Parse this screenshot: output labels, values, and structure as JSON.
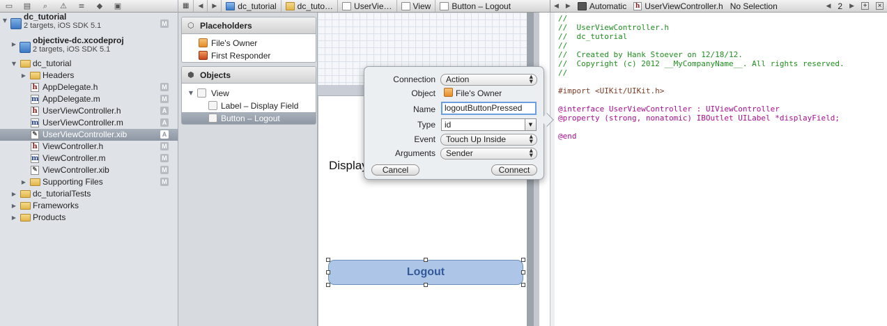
{
  "navigator": {
    "tree": [
      {
        "name": "dc_tutorial",
        "sub": "2 targets, iOS SDK 5.1",
        "status": "M"
      },
      {
        "name": "objective-dc.xcodeproj",
        "sub": "2 targets, iOS SDK 5.1"
      },
      {
        "name": "dc_tutorial"
      },
      {
        "name": "Headers"
      },
      {
        "name": "AppDelegate.h",
        "status": "M"
      },
      {
        "name": "AppDelegate.m",
        "status": "M"
      },
      {
        "name": "UserViewController.h",
        "status": "A"
      },
      {
        "name": "UserViewController.m",
        "status": "A"
      },
      {
        "name": "UserViewController.xib",
        "status": "A"
      },
      {
        "name": "ViewController.h",
        "status": "M"
      },
      {
        "name": "ViewController.m",
        "status": "M"
      },
      {
        "name": "ViewController.xib",
        "status": "M"
      },
      {
        "name": "Supporting Files",
        "status": "M"
      },
      {
        "name": "dc_tutorialTests"
      },
      {
        "name": "Frameworks"
      },
      {
        "name": "Products"
      }
    ]
  },
  "jumpbar": {
    "crumbs": [
      "dc_tutorial",
      "dc_tuto…",
      "UserVie…",
      "View",
      "Button – Logout"
    ]
  },
  "outline": {
    "placeholders_title": "Placeholders",
    "placeholders": [
      "File's Owner",
      "First Responder"
    ],
    "objects_title": "Objects",
    "objects": [
      "View",
      "Label – Display Field",
      "Button – Logout"
    ]
  },
  "canvas": {
    "display_label": "Display",
    "logout_button": "Logout"
  },
  "popover": {
    "connection_label": "Connection",
    "connection_value": "Action",
    "object_label": "Object",
    "object_value": "File's Owner",
    "name_label": "Name",
    "name_value": "logoutButtonPressed",
    "type_label": "Type",
    "type_value": "id",
    "event_label": "Event",
    "event_value": "Touch Up Inside",
    "arguments_label": "Arguments",
    "arguments_value": "Sender",
    "cancel": "Cancel",
    "connect": "Connect"
  },
  "editor": {
    "mode": "Automatic",
    "file": "UserViewController.h",
    "selection": "No Selection",
    "counter": "2"
  },
  "code_lines": [
    "//",
    "//  UserViewController.h",
    "//  dc_tutorial",
    "//",
    "//  Created by Hank Stoever on 12/18/12.",
    "//  Copyright (c) 2012 __MyCompanyName__. All rights reserved.",
    "//",
    "",
    "#import <UIKit/UIKit.h>",
    "",
    "@interface UserViewController : UIViewController",
    "@property (strong, nonatomic) IBOutlet UILabel *displayField;",
    "",
    "@end"
  ]
}
